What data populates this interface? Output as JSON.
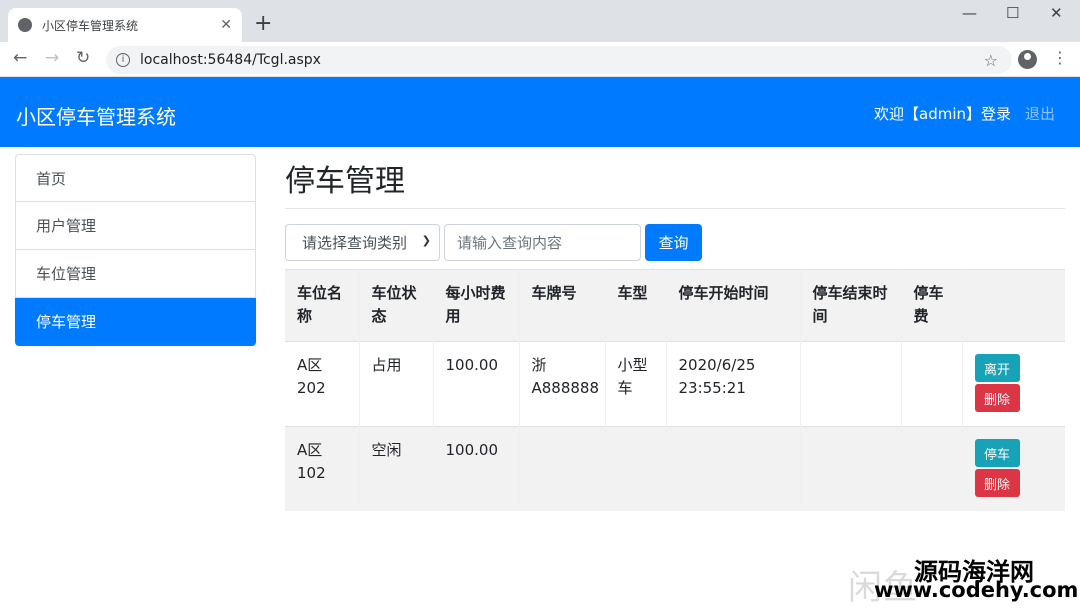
{
  "browser": {
    "tab_title": "小区停车管理系统",
    "tab_close": "✕",
    "new_tab": "+",
    "url": "localhost:56484/Tcgl.aspx",
    "minimize": "—",
    "maximize": "☐",
    "close": "✕"
  },
  "header": {
    "brand": "小区停车管理系统",
    "welcome": "欢迎【admin】登录",
    "logout": "退出"
  },
  "sidebar": {
    "items": [
      {
        "label": "首页"
      },
      {
        "label": "用户管理"
      },
      {
        "label": "车位管理"
      },
      {
        "label": "停车管理"
      }
    ],
    "active_index": 3
  },
  "main": {
    "title": "停车管理",
    "search": {
      "select_value": "请选择查询类别",
      "input_placeholder": "请输入查询内容",
      "button_label": "查询"
    },
    "table": {
      "headers": [
        "车位名称",
        "车位状态",
        "每小时费用",
        "车牌号",
        "车型",
        "停车开始时间",
        "停车结束时间",
        "停车费",
        ""
      ],
      "rows": [
        {
          "name": "A区202",
          "status": "占用",
          "fee": "100.00",
          "plate": "浙A888888",
          "type": "小型车",
          "start": "2020/6/25 23:55:21",
          "end": "",
          "cost": "",
          "action": "离开",
          "delete": "删除"
        },
        {
          "name": "A区102",
          "status": "空闲",
          "fee": "100.00",
          "plate": "",
          "type": "",
          "start": "",
          "end": "",
          "cost": "",
          "action": "停车",
          "delete": "删除"
        }
      ]
    }
  },
  "watermark": {
    "grey": "闲鱼",
    "site_name": "源码海洋网",
    "site_url": "www.codehy.com"
  },
  "colors": {
    "primary": "#007bff",
    "info": "#17a2b8",
    "danger": "#dc3545"
  }
}
